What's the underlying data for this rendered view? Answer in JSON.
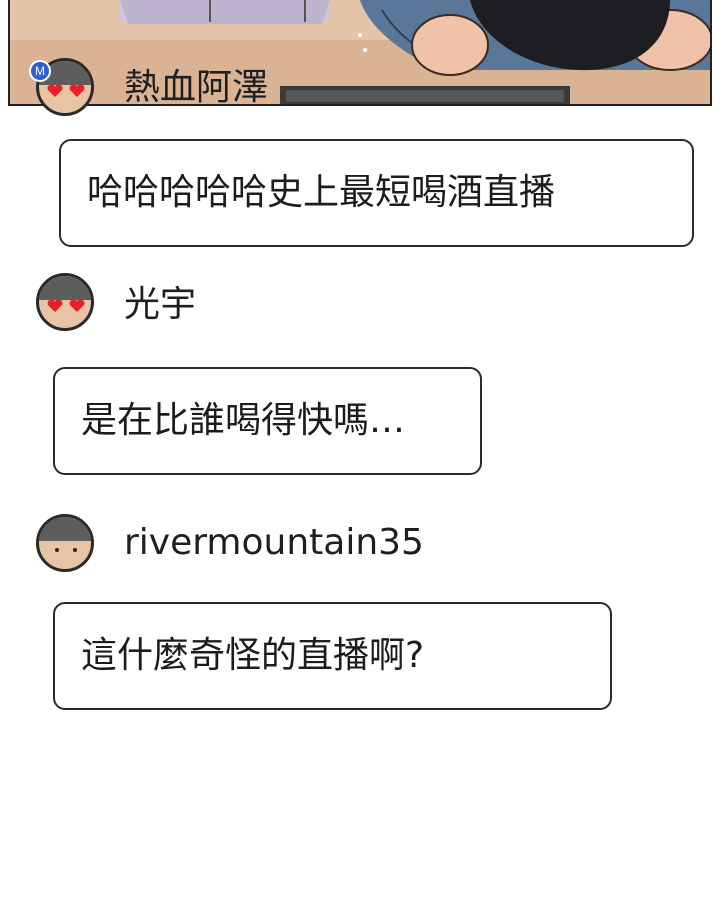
{
  "comments": [
    {
      "username": "熱血阿澤",
      "badge": "M",
      "avatar": "heart-eyes-avatar",
      "message": "哈哈哈哈哈史上最短喝酒直播"
    },
    {
      "username": "光宇",
      "avatar": "heart-eyes-avatar",
      "message": "是在比誰喝得快嗎…"
    },
    {
      "username": "rivermountain35",
      "avatar": "plain-face-avatar",
      "message": "這什麼奇怪的直播啊?"
    }
  ],
  "colors": {
    "badge_blue": "#2f5fd0",
    "heart_red": "#e8202a",
    "hair_gray": "#5d5d5d",
    "skin": "#e8c4a4"
  }
}
